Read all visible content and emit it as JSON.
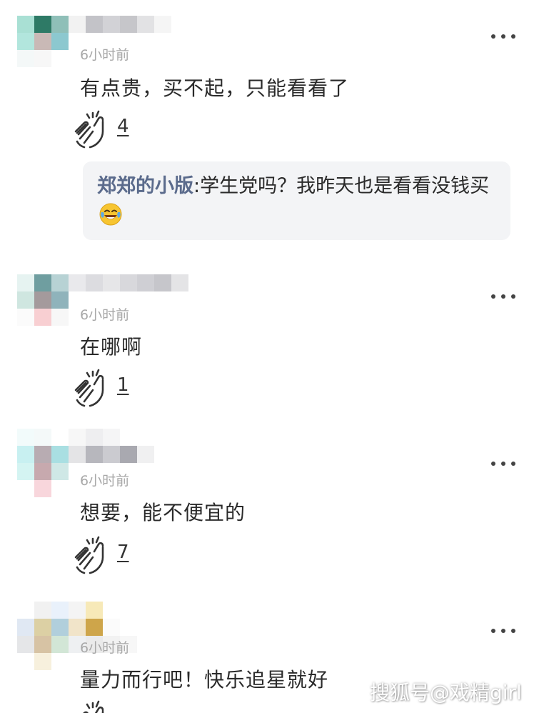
{
  "comments": [
    {
      "time": "6小时前",
      "text": "有点贵，买不起，只能看看了",
      "likes": "4",
      "reply": {
        "author": "郑郑的小版",
        "separator": ":",
        "text": "学生党吗？我昨天也是看看没钱买"
      }
    },
    {
      "time": "6小时前",
      "text": "在哪啊",
      "likes": "1"
    },
    {
      "time": "6小时前",
      "text": "想要，能不便宜的",
      "likes": "7"
    },
    {
      "time": "6小时前",
      "text": "量力而行吧！快乐追星就好"
    }
  ],
  "icons": {
    "like": "clap-icon",
    "more": "more-dots-icon",
    "emoji": "laughing-tears-emoji-icon"
  },
  "watermark": "搜狐号@戏精girl",
  "colors": {
    "author": "#5b6b8c",
    "time": "#a8a8a8",
    "reply_bg": "#f3f4f6"
  }
}
